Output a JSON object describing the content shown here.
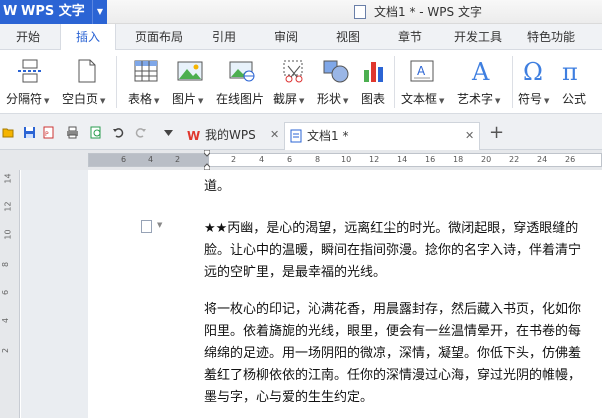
{
  "app": {
    "name": "WPS 文字",
    "logo": "W",
    "window_title": "文档1 * - WPS 文字"
  },
  "menu_tabs": [
    {
      "label": "开始"
    },
    {
      "label": "插入"
    },
    {
      "label": "页面布局"
    },
    {
      "label": "引用"
    },
    {
      "label": "审阅"
    },
    {
      "label": "视图"
    },
    {
      "label": "章节"
    },
    {
      "label": "开发工具"
    },
    {
      "label": "特色功能"
    }
  ],
  "active_menu_tab": "插入",
  "ribbon": {
    "page_break": "分隔符",
    "blank_page": "空白页",
    "table": "表格",
    "picture": "图片",
    "online_picture": "在线图片",
    "screenshot": "截屏",
    "shapes": "形状",
    "chart": "图表",
    "textbox": "文本框",
    "wordart": "艺术字",
    "symbol": "符号",
    "formula": "公式"
  },
  "doc_tabs": [
    {
      "label": "我的WPS"
    },
    {
      "label": "文档1 *"
    }
  ],
  "ruler": {
    "h_ticks": [
      "6",
      "4",
      "2",
      "2",
      "4",
      "6",
      "8",
      "10",
      "12",
      "14",
      "16",
      "18",
      "20",
      "22",
      "24",
      "26"
    ],
    "v_ticks": [
      "14",
      "12",
      "10",
      "8",
      "6",
      "4",
      "2"
    ]
  },
  "document": {
    "lines": [
      "道。",
      "★★丙幽，是心的渴望，远离红尘的时光。微闭起眼，穿透眼缝的",
      "脸。让心中的温暖，瞬间在指间弥漫。捻你的名字入诗，伴着清宁",
      "远的空旷里，是最幸福的光线。",
      "将一枚心的印记，沁满花香，用晨露封存，然后藏入书页，化如你",
      "阳里。依着旖旎的光线，眼里，便会有一丝温情晕开，在书卷的每",
      "绵绵的足迹。用一场阴阳的微凉，深情，凝望。你低下头，仿佛羞",
      "羞红了杨柳依依的江南。任你的深情漫过心海，穿过光阴的帷幔，",
      "墨与字，心与爱的生生约定。"
    ]
  },
  "colors": {
    "brand": "#2b64d4",
    "active_tab_text": "#2b64d4",
    "wps_tab_icon": "#e0372e"
  }
}
